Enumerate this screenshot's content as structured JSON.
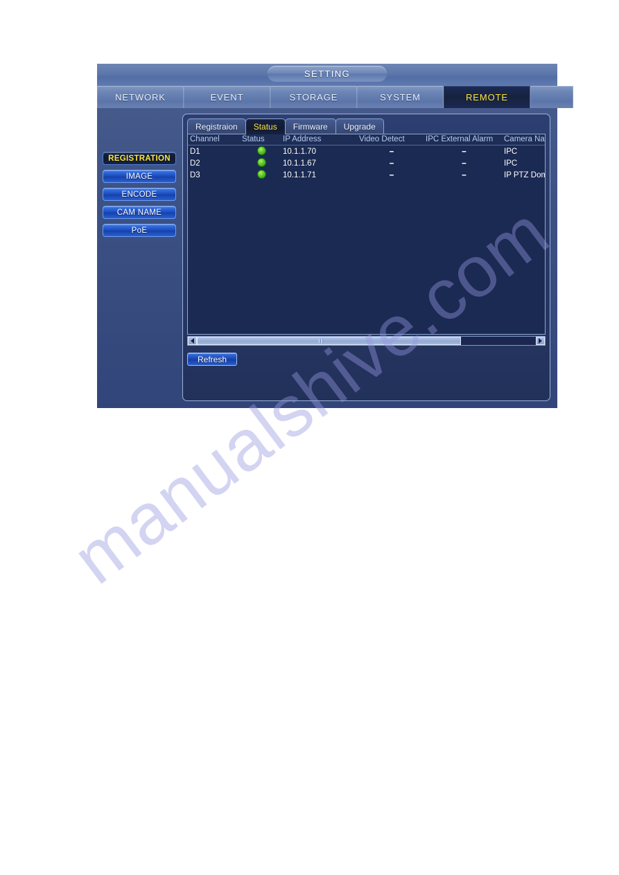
{
  "window": {
    "title": "SETTING"
  },
  "top_tabs": [
    {
      "label": "NETWORK",
      "selected": false
    },
    {
      "label": "EVENT",
      "selected": false
    },
    {
      "label": "STORAGE",
      "selected": false
    },
    {
      "label": "SYSTEM",
      "selected": false
    },
    {
      "label": "REMOTE",
      "selected": true
    },
    {
      "label": "",
      "selected": false
    }
  ],
  "sidebar": {
    "items": [
      {
        "label": "REGISTRATION",
        "selected": true
      },
      {
        "label": "IMAGE",
        "selected": false
      },
      {
        "label": "ENCODE",
        "selected": false
      },
      {
        "label": "CAM NAME",
        "selected": false
      },
      {
        "label": "PoE",
        "selected": false
      }
    ]
  },
  "inner_tabs": [
    {
      "label": "Registraion",
      "selected": false
    },
    {
      "label": "Status",
      "selected": true
    },
    {
      "label": "Firmware",
      "selected": false
    },
    {
      "label": "Upgrade",
      "selected": false
    }
  ],
  "table": {
    "columns": [
      "Channel",
      "Status",
      "IP Address",
      "Video Detect",
      "IPC External Alarm",
      "Camera Nam"
    ],
    "rows": [
      {
        "channel": "D1",
        "status": "online",
        "ip_address": "10.1.1.70",
        "video_detect": "--",
        "ipc_external_alarm": "--",
        "camera_name": "IPC"
      },
      {
        "channel": "D2",
        "status": "online",
        "ip_address": "10.1.1.67",
        "video_detect": "--",
        "ipc_external_alarm": "--",
        "camera_name": "IPC"
      },
      {
        "channel": "D3",
        "status": "online",
        "ip_address": "10.1.1.71",
        "video_detect": "--",
        "ipc_external_alarm": "--",
        "camera_name": "IP PTZ Dome"
      }
    ]
  },
  "scrollbar": {
    "left_arrow_icon": "triangle-left-icon",
    "right_arrow_icon": "triangle-right-icon",
    "thumb_percent": 78
  },
  "buttons": {
    "refresh": "Refresh"
  },
  "watermark": {
    "text": "manualshive.com"
  },
  "colors": {
    "accent_yellow": "#ffe63a",
    "status_green": "#54c42c",
    "dash_yellow": "#f2c21a",
    "panel_blue": "#2d3f72"
  }
}
